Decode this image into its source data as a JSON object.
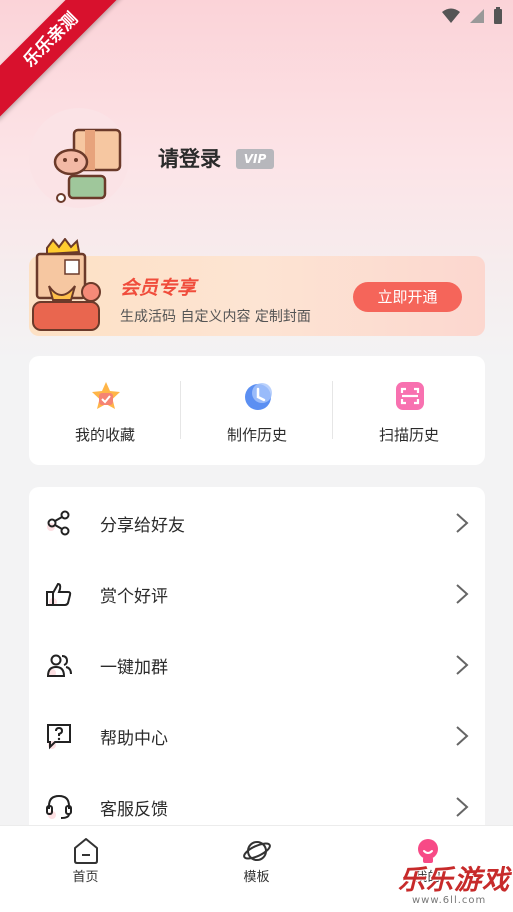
{
  "status_bar": {
    "ribbon": "乐乐亲测"
  },
  "profile": {
    "login_text": "请登录",
    "vip_badge": "VIP"
  },
  "member": {
    "title": "会员专享",
    "subtitle": "生成活码 自定义内容 定制封面",
    "button": "立即开通"
  },
  "quick": [
    {
      "label": "我的收藏",
      "icon": "star-badge-icon"
    },
    {
      "label": "制作历史",
      "icon": "clock-icon"
    },
    {
      "label": "扫描历史",
      "icon": "scan-icon"
    }
  ],
  "menu": [
    {
      "label": "分享给好友",
      "icon": "share-icon"
    },
    {
      "label": "赏个好评",
      "icon": "thumbs-up-icon"
    },
    {
      "label": "一键加群",
      "icon": "group-icon"
    },
    {
      "label": "帮助中心",
      "icon": "help-icon"
    },
    {
      "label": "客服反馈",
      "icon": "headset-icon"
    }
  ],
  "nav": [
    {
      "label": "首页",
      "icon": "home-icon"
    },
    {
      "label": "模板",
      "icon": "planet-icon"
    },
    {
      "label": "我的",
      "icon": "bulb-icon",
      "active": true
    }
  ],
  "watermark": {
    "text": "乐乐游戏",
    "url": "www.6ll.com"
  },
  "colors": {
    "accent": "#f5655a",
    "member_title": "#f04d3c",
    "ribbon": "#d8112d"
  }
}
